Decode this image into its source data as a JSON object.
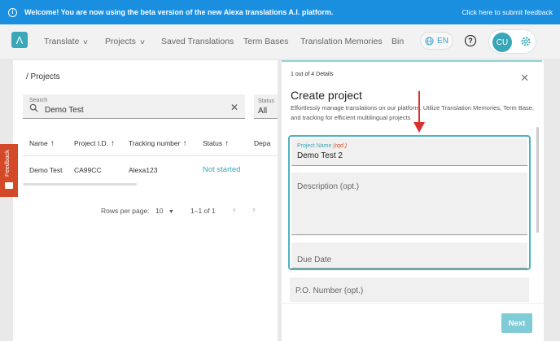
{
  "banner": {
    "message": "Welcome! You are now using the beta version of the new Alexa translations A.I. platform.",
    "link": "Click here to submit feedback",
    "color": "#1a8fe0"
  },
  "nav": {
    "logo": "Λ",
    "items": [
      "Translate",
      "Projects",
      "Saved Translations",
      "Term Bases",
      "Translation Memories",
      "Bin"
    ],
    "language": "EN",
    "help": "?",
    "avatar": "CU"
  },
  "projects": {
    "breadcrumb": "/ Projects",
    "search": {
      "label": "Search",
      "value": "Demo Test"
    },
    "status_filter": {
      "label": "Status",
      "value": "All"
    },
    "columns": [
      "Name",
      "Project I.D.",
      "Tracking number",
      "Status",
      "Depa"
    ],
    "rows": [
      {
        "name": "Demo Test",
        "id": "CA99CC",
        "tracking": "Alexa123",
        "status": "Not started"
      }
    ],
    "pagination": {
      "rows_label": "Rows per page:",
      "rows_value": "10",
      "range": "1–1 of 1"
    }
  },
  "feedback": {
    "label": "Feedback",
    "color": "#d44a28"
  },
  "panel": {
    "steps": "1 out of 4 Details",
    "title": "Create project",
    "description": "Effortlessly manage translations on our platform. Utilize Translation Memories, Term Base, and tracking for efficient multilingual projects",
    "fields": {
      "name_label": "Project Name",
      "name_required": "(rqd.)",
      "name_value": "Demo Test 2",
      "description_placeholder": "Description (opt.)",
      "due_date_placeholder": "Due Date",
      "po_placeholder": "P.O. Number (opt.)"
    },
    "next": "Next",
    "accent": "#4db3c3"
  }
}
